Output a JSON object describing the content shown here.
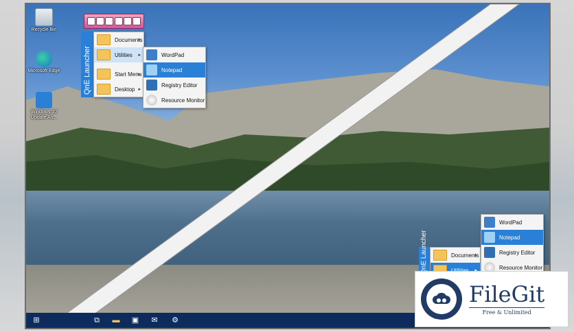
{
  "desktop": {
    "icons": [
      {
        "label": "Recycle Bin"
      },
      {
        "label": "Microsoft Edge"
      },
      {
        "label": "Windows 10 Update As..."
      }
    ]
  },
  "launcher": {
    "title": "QnE Launcher",
    "menu_items": [
      {
        "label": "Documents"
      },
      {
        "label": "Utilities"
      },
      {
        "label": "Start Menu"
      },
      {
        "label": "Desktop"
      }
    ],
    "submenu_items": [
      {
        "label": "WordPad"
      },
      {
        "label": "Notepad"
      },
      {
        "label": "Registry Editor"
      },
      {
        "label": "Resource Monitor"
      }
    ]
  },
  "launcher_small": {
    "title": "QnE Launcher",
    "menu_items": [
      {
        "label": "Documents"
      },
      {
        "label": "Utilities"
      }
    ],
    "submenu_items": [
      {
        "label": "WordPad"
      },
      {
        "label": "Notepad"
      },
      {
        "label": "Registry Editor"
      },
      {
        "label": "Resource Monitor"
      }
    ]
  },
  "watermark": {
    "name": "FileGit",
    "tagline": "Free & Unlimited"
  },
  "colors": {
    "accent": "#2a7fd6",
    "taskbar": "#0d2b5c",
    "brand": "#1f3b66"
  }
}
